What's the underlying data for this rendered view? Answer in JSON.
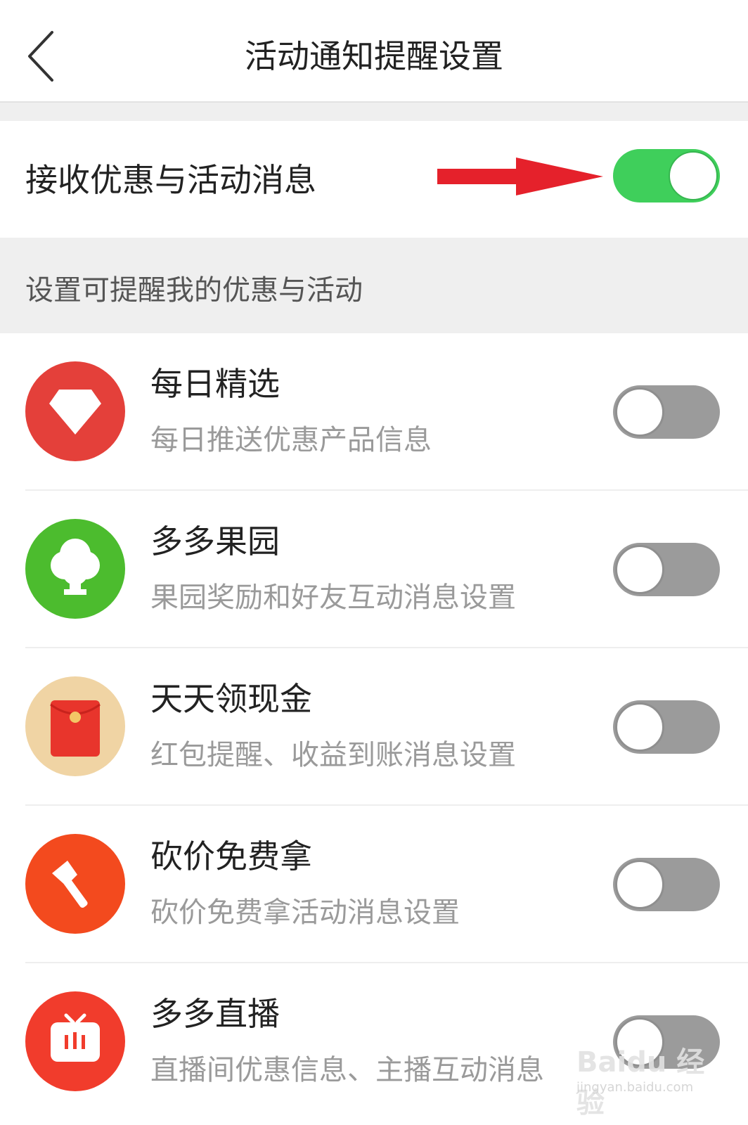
{
  "header": {
    "title": "活动通知提醒设置"
  },
  "main_setting": {
    "label": "接收优惠与活动消息",
    "enabled": true
  },
  "section": {
    "label": "设置可提醒我的优惠与活动"
  },
  "items": [
    {
      "title": "每日精选",
      "subtitle": "每日推送优惠产品信息",
      "icon": "diamond-icon",
      "color": "#e4403a",
      "enabled": false
    },
    {
      "title": "多多果园",
      "subtitle": "果园奖励和好友互动消息设置",
      "icon": "tree-icon",
      "color": "#4cbc2e",
      "enabled": false
    },
    {
      "title": "天天领现金",
      "subtitle": "红包提醒、收益到账消息设置",
      "icon": "red-envelope-icon",
      "color": "#f0d4a4",
      "enabled": false
    },
    {
      "title": "砍价免费拿",
      "subtitle": "砍价免费拿活动消息设置",
      "icon": "axe-icon",
      "color": "#f34a1e",
      "enabled": false
    },
    {
      "title": "多多直播",
      "subtitle": "直播间优惠信息、主播互动消息",
      "icon": "tv-icon",
      "color": "#f13c2c",
      "enabled": false
    }
  ],
  "watermark": {
    "main": "Baidu 经验",
    "sub": "jingyan.baidu.com"
  },
  "colors": {
    "toggle_on": "#3fcf5b",
    "toggle_off": "#9b9b9b",
    "arrow": "#e5212b"
  }
}
